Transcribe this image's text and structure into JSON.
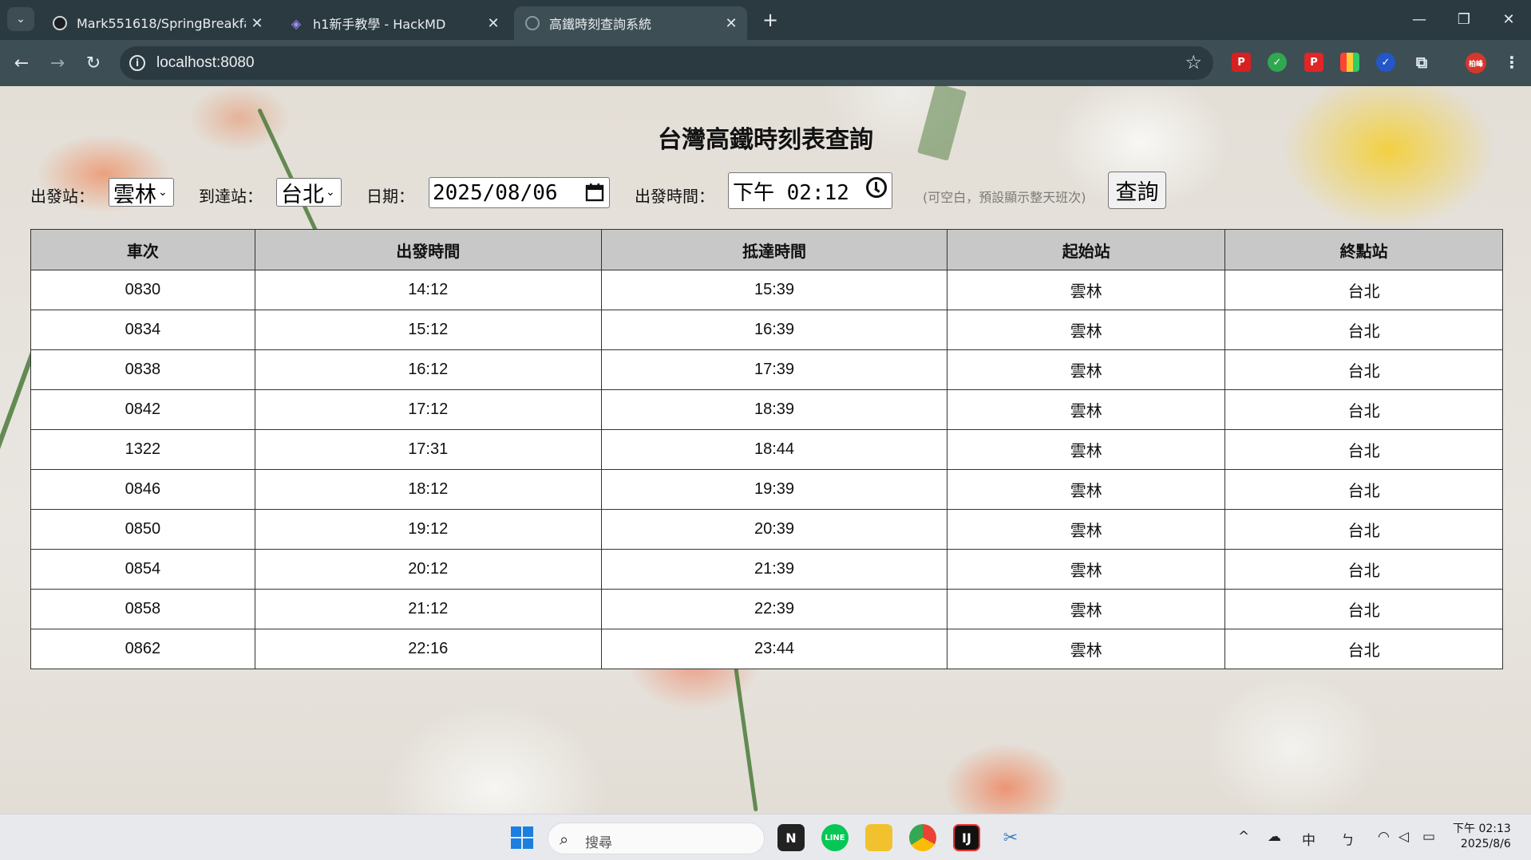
{
  "browser": {
    "tabs": [
      {
        "title": "Mark551618/SpringBreakfast",
        "icon": "github-icon"
      },
      {
        "title": "h1新手教學 - HackMD",
        "icon": "hackmd-icon"
      },
      {
        "title": "高鐵時刻查詢系統",
        "icon": "globe-icon",
        "active": true
      }
    ],
    "url": "localhost:8080",
    "profile_label": "柏峰"
  },
  "page": {
    "title": "台灣高鐵時刻表查詢",
    "form": {
      "departure_label": "出發站：",
      "departure_value": "雲林",
      "arrival_label": "到達站：",
      "arrival_value": "台北",
      "date_label": "日期：",
      "date_value": "2025/08/06",
      "time_label": "出發時間：",
      "time_value": "下午 02:12",
      "time_hint": "(可空白，預設顯示整天班次)",
      "query_button": "查詢"
    },
    "table": {
      "headers": [
        "車次",
        "出發時間",
        "抵達時間",
        "起始站",
        "終點站"
      ],
      "rows": [
        [
          "0830",
          "14:12",
          "15:39",
          "雲林",
          "台北"
        ],
        [
          "0834",
          "15:12",
          "16:39",
          "雲林",
          "台北"
        ],
        [
          "0838",
          "16:12",
          "17:39",
          "雲林",
          "台北"
        ],
        [
          "0842",
          "17:12",
          "18:39",
          "雲林",
          "台北"
        ],
        [
          "1322",
          "17:31",
          "18:44",
          "雲林",
          "台北"
        ],
        [
          "0846",
          "18:12",
          "19:39",
          "雲林",
          "台北"
        ],
        [
          "0850",
          "19:12",
          "20:39",
          "雲林",
          "台北"
        ],
        [
          "0854",
          "20:12",
          "21:39",
          "雲林",
          "台北"
        ],
        [
          "0858",
          "21:12",
          "22:39",
          "雲林",
          "台北"
        ],
        [
          "0862",
          "22:16",
          "23:44",
          "雲林",
          "台北"
        ]
      ]
    }
  },
  "taskbar": {
    "search_placeholder": "搜尋",
    "ime": "中",
    "clock_time": "下午 02:13",
    "clock_date": "2025/8/6"
  }
}
